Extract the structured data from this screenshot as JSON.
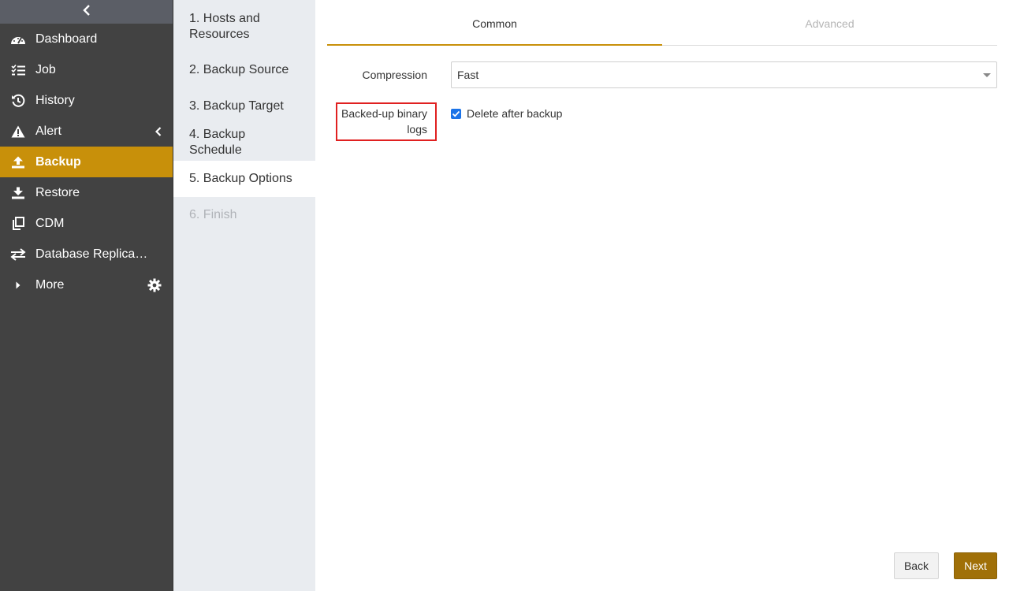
{
  "sidebar": {
    "items": [
      {
        "label": "Dashboard",
        "icon": "dashboard-icon"
      },
      {
        "label": "Job",
        "icon": "job-list-icon"
      },
      {
        "label": "History",
        "icon": "history-icon"
      },
      {
        "label": "Alert",
        "icon": "alert-icon"
      },
      {
        "label": "Backup",
        "icon": "backup-upload-icon",
        "active": true
      },
      {
        "label": "Restore",
        "icon": "restore-download-icon"
      },
      {
        "label": "CDM",
        "icon": "cdm-copy-icon"
      },
      {
        "label": "Database Replica…",
        "icon": "replication-arrows-icon"
      },
      {
        "label": "More",
        "icon": "caret-right-icon"
      }
    ]
  },
  "steps": [
    {
      "label": "1. Hosts and Resources"
    },
    {
      "label": "2. Backup Source"
    },
    {
      "label": "3. Backup Target"
    },
    {
      "label": "4. Backup Schedule"
    },
    {
      "label": "5. Backup Options"
    },
    {
      "label": "6. Finish"
    }
  ],
  "tabs": [
    {
      "label": "Common"
    },
    {
      "label": "Advanced"
    }
  ],
  "form": {
    "compression_label": "Compression",
    "compression_value": "Fast",
    "binlog_label": "Backed-up binary logs",
    "binlog_checkbox_label": "Delete after backup",
    "binlog_checked": true
  },
  "buttons": {
    "back": "Back",
    "next": "Next"
  },
  "colors": {
    "accent": "#c8900a",
    "next_button": "#a07008",
    "sidebar_bg": "#424242",
    "steps_bg": "#e9ecf0",
    "highlight": "#e02020",
    "checkbox": "#1a73e8"
  }
}
